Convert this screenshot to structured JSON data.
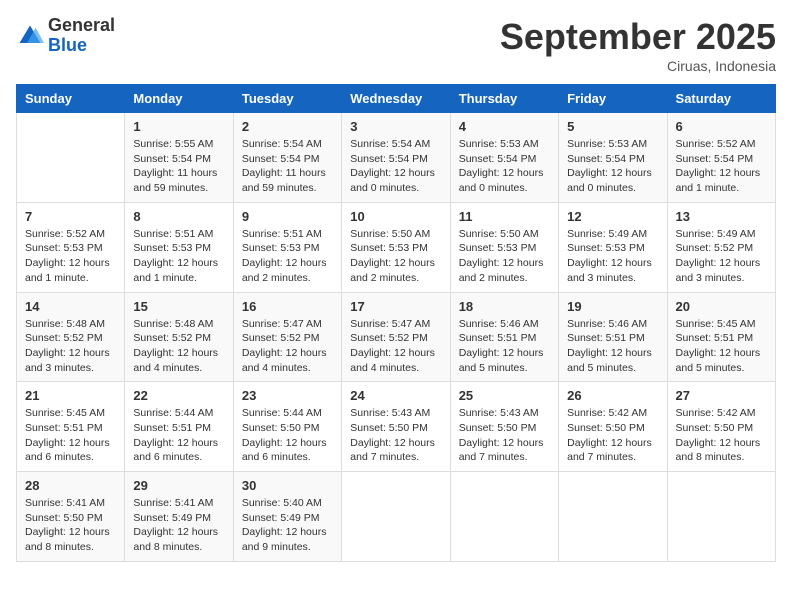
{
  "header": {
    "logo": {
      "general": "General",
      "blue": "Blue"
    },
    "title": "September 2025",
    "subtitle": "Ciruas, Indonesia"
  },
  "calendar": {
    "days_of_week": [
      "Sunday",
      "Monday",
      "Tuesday",
      "Wednesday",
      "Thursday",
      "Friday",
      "Saturday"
    ],
    "weeks": [
      [
        {
          "day": "",
          "info": ""
        },
        {
          "day": "1",
          "info": "Sunrise: 5:55 AM\nSunset: 5:54 PM\nDaylight: 11 hours\nand 59 minutes."
        },
        {
          "day": "2",
          "info": "Sunrise: 5:54 AM\nSunset: 5:54 PM\nDaylight: 11 hours\nand 59 minutes."
        },
        {
          "day": "3",
          "info": "Sunrise: 5:54 AM\nSunset: 5:54 PM\nDaylight: 12 hours\nand 0 minutes."
        },
        {
          "day": "4",
          "info": "Sunrise: 5:53 AM\nSunset: 5:54 PM\nDaylight: 12 hours\nand 0 minutes."
        },
        {
          "day": "5",
          "info": "Sunrise: 5:53 AM\nSunset: 5:54 PM\nDaylight: 12 hours\nand 0 minutes."
        },
        {
          "day": "6",
          "info": "Sunrise: 5:52 AM\nSunset: 5:54 PM\nDaylight: 12 hours\nand 1 minute."
        }
      ],
      [
        {
          "day": "7",
          "info": "Sunrise: 5:52 AM\nSunset: 5:53 PM\nDaylight: 12 hours\nand 1 minute."
        },
        {
          "day": "8",
          "info": "Sunrise: 5:51 AM\nSunset: 5:53 PM\nDaylight: 12 hours\nand 1 minute."
        },
        {
          "day": "9",
          "info": "Sunrise: 5:51 AM\nSunset: 5:53 PM\nDaylight: 12 hours\nand 2 minutes."
        },
        {
          "day": "10",
          "info": "Sunrise: 5:50 AM\nSunset: 5:53 PM\nDaylight: 12 hours\nand 2 minutes."
        },
        {
          "day": "11",
          "info": "Sunrise: 5:50 AM\nSunset: 5:53 PM\nDaylight: 12 hours\nand 2 minutes."
        },
        {
          "day": "12",
          "info": "Sunrise: 5:49 AM\nSunset: 5:53 PM\nDaylight: 12 hours\nand 3 minutes."
        },
        {
          "day": "13",
          "info": "Sunrise: 5:49 AM\nSunset: 5:52 PM\nDaylight: 12 hours\nand 3 minutes."
        }
      ],
      [
        {
          "day": "14",
          "info": "Sunrise: 5:48 AM\nSunset: 5:52 PM\nDaylight: 12 hours\nand 3 minutes."
        },
        {
          "day": "15",
          "info": "Sunrise: 5:48 AM\nSunset: 5:52 PM\nDaylight: 12 hours\nand 4 minutes."
        },
        {
          "day": "16",
          "info": "Sunrise: 5:47 AM\nSunset: 5:52 PM\nDaylight: 12 hours\nand 4 minutes."
        },
        {
          "day": "17",
          "info": "Sunrise: 5:47 AM\nSunset: 5:52 PM\nDaylight: 12 hours\nand 4 minutes."
        },
        {
          "day": "18",
          "info": "Sunrise: 5:46 AM\nSunset: 5:51 PM\nDaylight: 12 hours\nand 5 minutes."
        },
        {
          "day": "19",
          "info": "Sunrise: 5:46 AM\nSunset: 5:51 PM\nDaylight: 12 hours\nand 5 minutes."
        },
        {
          "day": "20",
          "info": "Sunrise: 5:45 AM\nSunset: 5:51 PM\nDaylight: 12 hours\nand 5 minutes."
        }
      ],
      [
        {
          "day": "21",
          "info": "Sunrise: 5:45 AM\nSunset: 5:51 PM\nDaylight: 12 hours\nand 6 minutes."
        },
        {
          "day": "22",
          "info": "Sunrise: 5:44 AM\nSunset: 5:51 PM\nDaylight: 12 hours\nand 6 minutes."
        },
        {
          "day": "23",
          "info": "Sunrise: 5:44 AM\nSunset: 5:50 PM\nDaylight: 12 hours\nand 6 minutes."
        },
        {
          "day": "24",
          "info": "Sunrise: 5:43 AM\nSunset: 5:50 PM\nDaylight: 12 hours\nand 7 minutes."
        },
        {
          "day": "25",
          "info": "Sunrise: 5:43 AM\nSunset: 5:50 PM\nDaylight: 12 hours\nand 7 minutes."
        },
        {
          "day": "26",
          "info": "Sunrise: 5:42 AM\nSunset: 5:50 PM\nDaylight: 12 hours\nand 7 minutes."
        },
        {
          "day": "27",
          "info": "Sunrise: 5:42 AM\nSunset: 5:50 PM\nDaylight: 12 hours\nand 8 minutes."
        }
      ],
      [
        {
          "day": "28",
          "info": "Sunrise: 5:41 AM\nSunset: 5:50 PM\nDaylight: 12 hours\nand 8 minutes."
        },
        {
          "day": "29",
          "info": "Sunrise: 5:41 AM\nSunset: 5:49 PM\nDaylight: 12 hours\nand 8 minutes."
        },
        {
          "day": "30",
          "info": "Sunrise: 5:40 AM\nSunset: 5:49 PM\nDaylight: 12 hours\nand 9 minutes."
        },
        {
          "day": "",
          "info": ""
        },
        {
          "day": "",
          "info": ""
        },
        {
          "day": "",
          "info": ""
        },
        {
          "day": "",
          "info": ""
        }
      ]
    ]
  }
}
